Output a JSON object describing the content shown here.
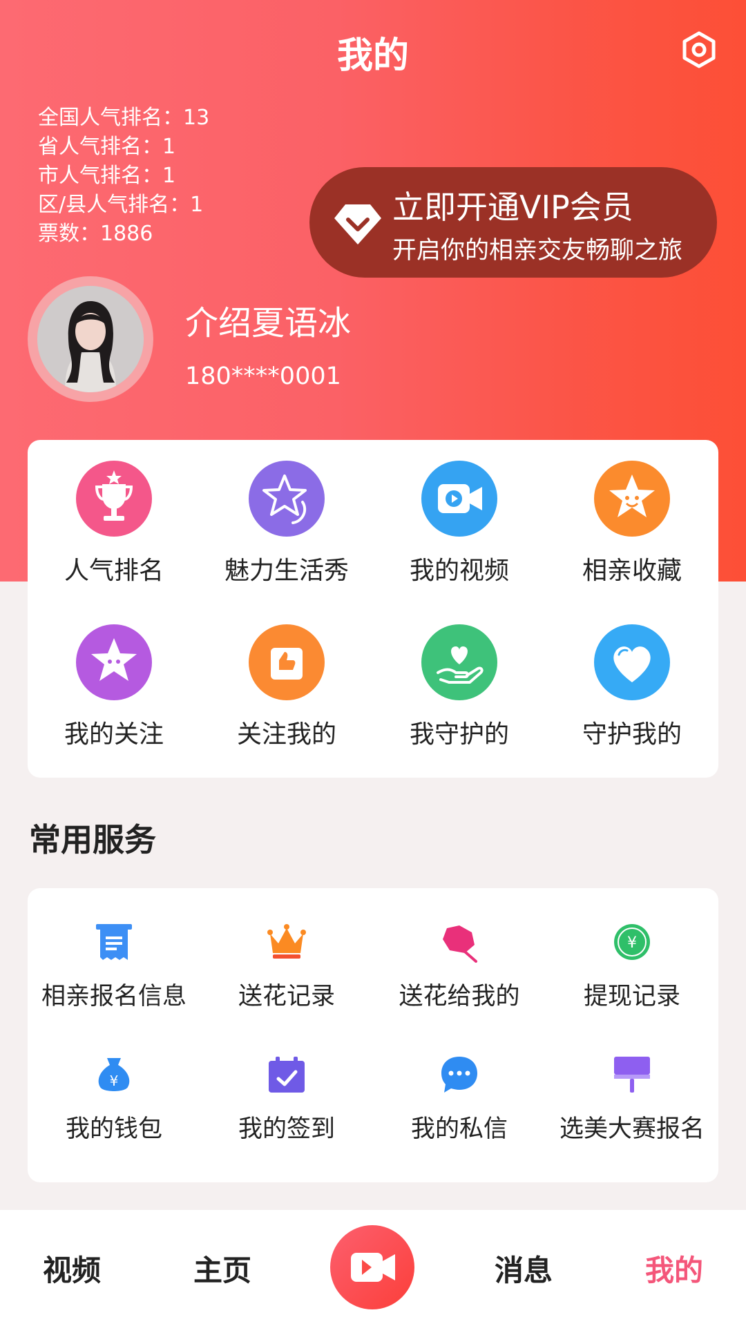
{
  "header": {
    "title": "我的"
  },
  "stats": [
    "全国人气排名：13",
    "省人气排名：1",
    "市人气排名：1",
    "区/县人气排名：1",
    "票数：1886"
  ],
  "vip": {
    "title": "立即开通VIP会员",
    "subtitle": "开启你的相亲交友畅聊之旅"
  },
  "user": {
    "name": "介绍夏语冰",
    "phone": "180****0001"
  },
  "features": [
    {
      "label": "人气排名",
      "icon": "trophy-icon",
      "color": "#f4578a"
    },
    {
      "label": "魅力生活秀",
      "icon": "star-badge-icon",
      "color": "#8b6ce6"
    },
    {
      "label": "我的视频",
      "icon": "video-camera-icon",
      "color": "#35a3f2"
    },
    {
      "label": "相亲收藏",
      "icon": "smiling-star-icon",
      "color": "#fb8b2d"
    },
    {
      "label": "我的关注",
      "icon": "star-icon",
      "color": "#b55ae0"
    },
    {
      "label": "关注我的",
      "icon": "thumbs-up-icon",
      "color": "#fb8a32"
    },
    {
      "label": "我守护的",
      "icon": "heart-hand-icon",
      "color": "#3ec27a"
    },
    {
      "label": "守护我的",
      "icon": "heart-icon",
      "color": "#36aaf5"
    }
  ],
  "services_title": "常用服务",
  "services": [
    {
      "label": "相亲报名信息",
      "icon": "receipt-icon",
      "color": "#3d8ff5"
    },
    {
      "label": "送花记录",
      "icon": "crown-icon",
      "color": "#fb8a22"
    },
    {
      "label": "送花给我的",
      "icon": "flower-icon",
      "color": "#e9307a"
    },
    {
      "label": "提现记录",
      "icon": "yen-coin-icon",
      "color": "#2fbf69"
    },
    {
      "label": "我的钱包",
      "icon": "money-bag-icon",
      "color": "#2f8cf2"
    },
    {
      "label": "我的签到",
      "icon": "calendar-check-icon",
      "color": "#6f5ae6"
    },
    {
      "label": "我的私信",
      "icon": "chat-bubble-icon",
      "color": "#2f8cf2"
    },
    {
      "label": "选美大赛报名",
      "icon": "paint-roller-icon",
      "color": "#8e5ff0"
    }
  ],
  "tabbar": {
    "tabs": [
      {
        "label": "视频"
      },
      {
        "label": "主页"
      },
      {
        "label": "消息"
      },
      {
        "label": "我的"
      }
    ],
    "active_color": "#f4567a"
  }
}
